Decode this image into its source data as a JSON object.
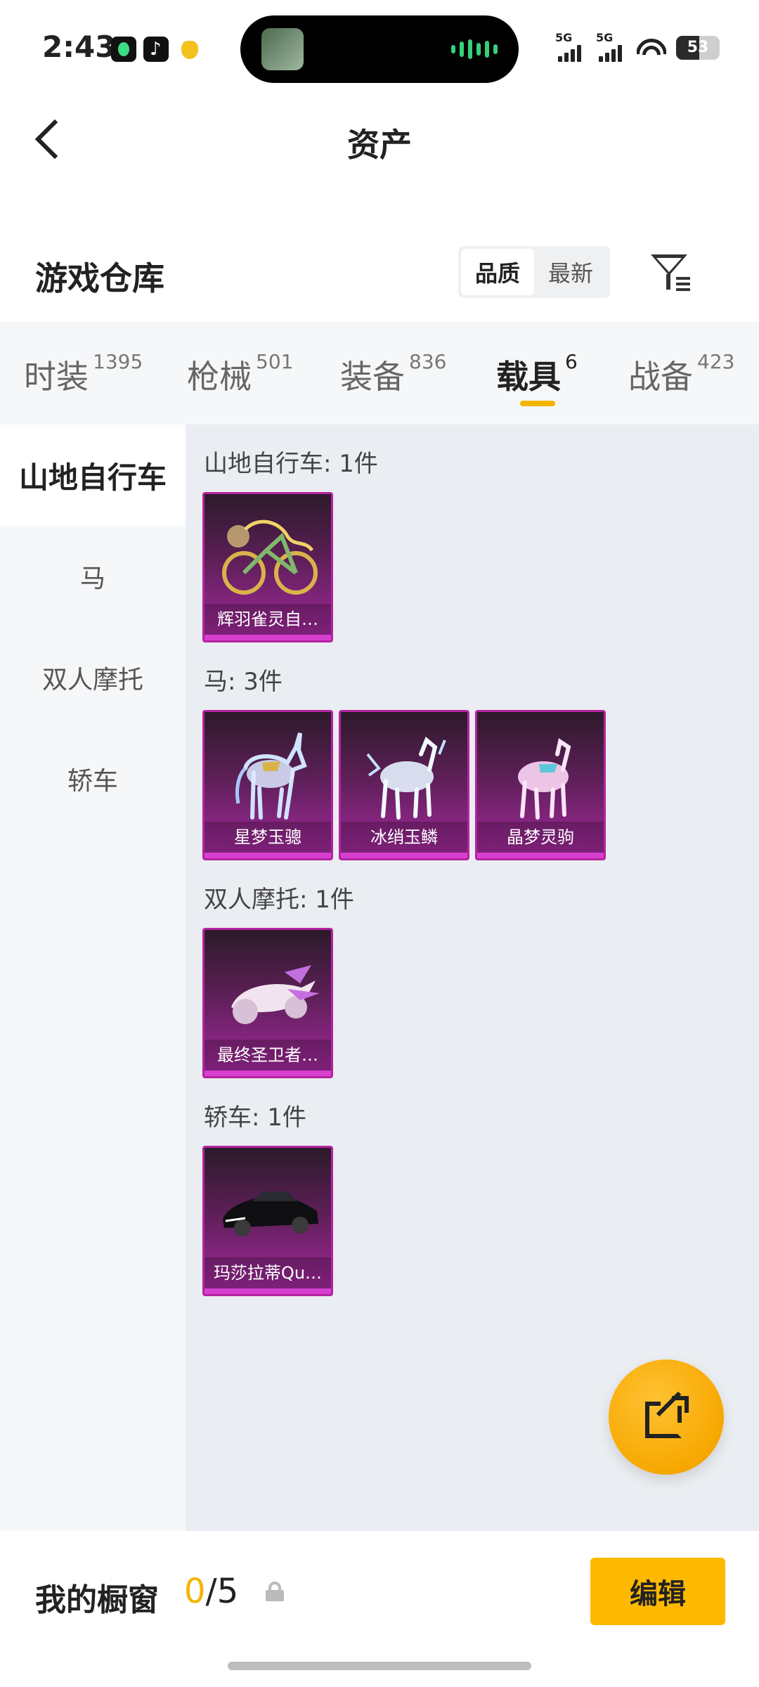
{
  "status_bar": {
    "time": "2:43",
    "network_1": "5G",
    "network_2": "5G",
    "battery": "53"
  },
  "header": {
    "title": "资产"
  },
  "section": {
    "title": "游戏仓库",
    "sort_options": [
      "品质",
      "最新"
    ],
    "active_sort": "品质"
  },
  "tabs": [
    {
      "label": "时装",
      "count": "1395"
    },
    {
      "label": "枪械",
      "count": "501"
    },
    {
      "label": "装备",
      "count": "836"
    },
    {
      "label": "载具",
      "count": "6"
    },
    {
      "label": "战备",
      "count": "423"
    }
  ],
  "active_tab": "载具",
  "sidebar": {
    "items": [
      "山地自行车",
      "马",
      "双人摩托",
      "轿车"
    ],
    "active": "山地自行车"
  },
  "groups": [
    {
      "title": "山地自行车: 1件",
      "items": [
        {
          "name": "辉羽雀灵自…",
          "icon": "bicycle-icon"
        }
      ]
    },
    {
      "title": "马: 3件",
      "items": [
        {
          "name": "星梦玉骢",
          "icon": "horse-icon"
        },
        {
          "name": "冰绡玉鳞",
          "icon": "horse-icon"
        },
        {
          "name": "晶梦灵驹",
          "icon": "horse-icon"
        }
      ]
    },
    {
      "title": "双人摩托: 1件",
      "items": [
        {
          "name": "最终圣卫者…",
          "icon": "motorcycle-icon"
        }
      ]
    },
    {
      "title": "轿车: 1件",
      "items": [
        {
          "name": "玛莎拉蒂Qu…",
          "icon": "car-icon"
        }
      ]
    }
  ],
  "bottom_bar": {
    "showcase_label": "我的橱窗",
    "showcase_current": "0",
    "showcase_total": "/5",
    "edit_label": "编辑"
  },
  "colors": {
    "accent": "#f5b400",
    "card_border": "#b5239f",
    "card_gradient_bottom": "#a72aa0"
  }
}
